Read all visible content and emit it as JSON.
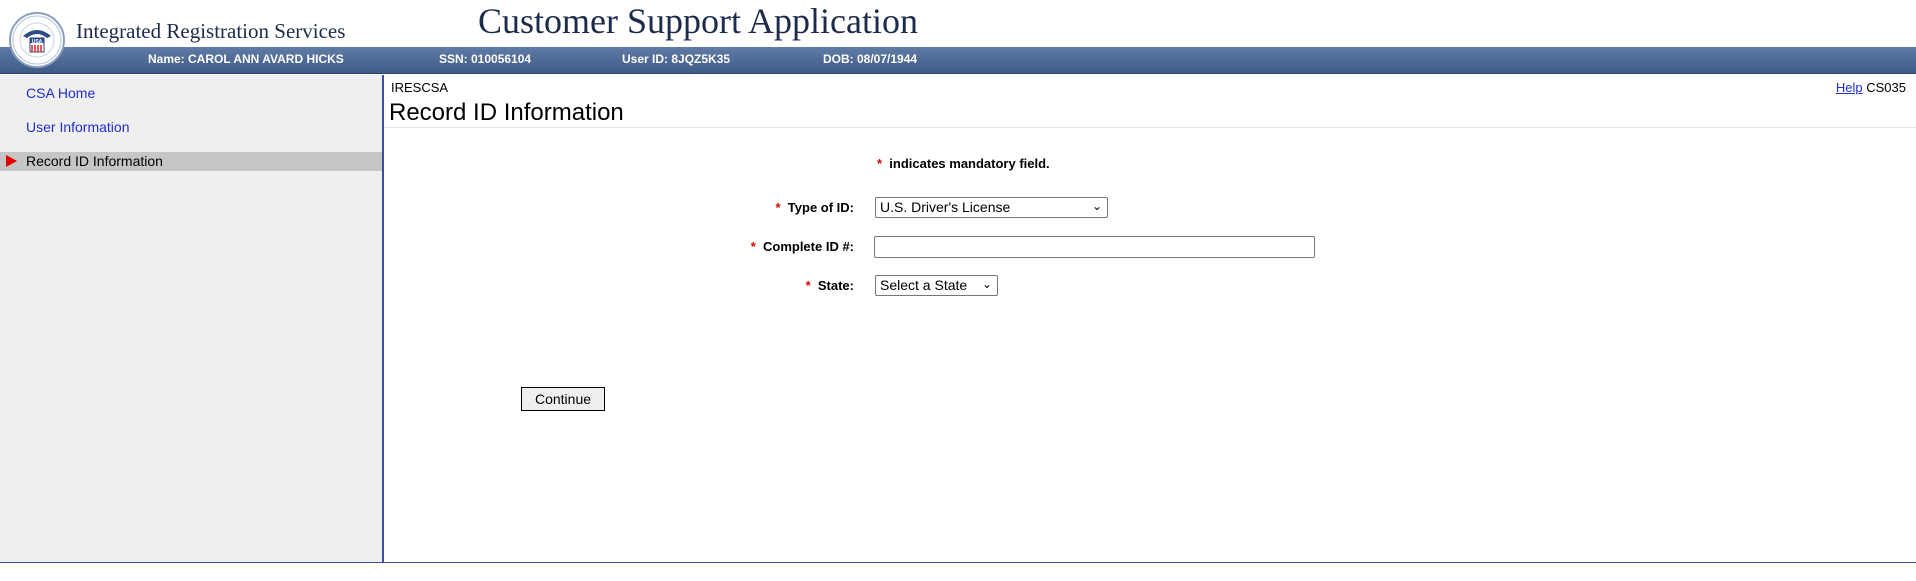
{
  "header": {
    "org_name": "Integrated Registration Services",
    "app_title": "Customer Support Application",
    "seal_text": "USA",
    "user_bar": {
      "name": "Name: CAROL ANN AVARD HICKS",
      "ssn": "SSN: 010056104",
      "user_id": "User ID: 8JQZ5K35",
      "dob": "DOB: 08/07/1944"
    }
  },
  "sidebar": {
    "items": [
      {
        "label": "CSA Home"
      },
      {
        "label": "User Information"
      },
      {
        "label": "Record ID Information"
      }
    ]
  },
  "main": {
    "app_code": "IRESCSA",
    "help_label": "Help",
    "screen_code": "CS035",
    "page_title": "Record ID Information",
    "mandatory_note": "indicates mandatory field.",
    "required_marker": "*",
    "form": {
      "type_of_id": {
        "label": "Type of ID:",
        "value": "U.S. Driver's License"
      },
      "complete_id": {
        "label": "Complete ID #:",
        "value": ""
      },
      "state": {
        "label": "State:",
        "value": "Select a State"
      }
    },
    "continue_label": "Continue"
  },
  "colors": {
    "header_bar": "#4a6694",
    "link": "#1f2fd0",
    "required": "#e00000",
    "sidebar_bg": "#efefef",
    "active_item_bg": "#c6c6c6"
  },
  "icons": {
    "seal": "agency-seal-icon",
    "active_arrow": "right-triangle-icon",
    "dropdown": "chevron-down-icon"
  }
}
